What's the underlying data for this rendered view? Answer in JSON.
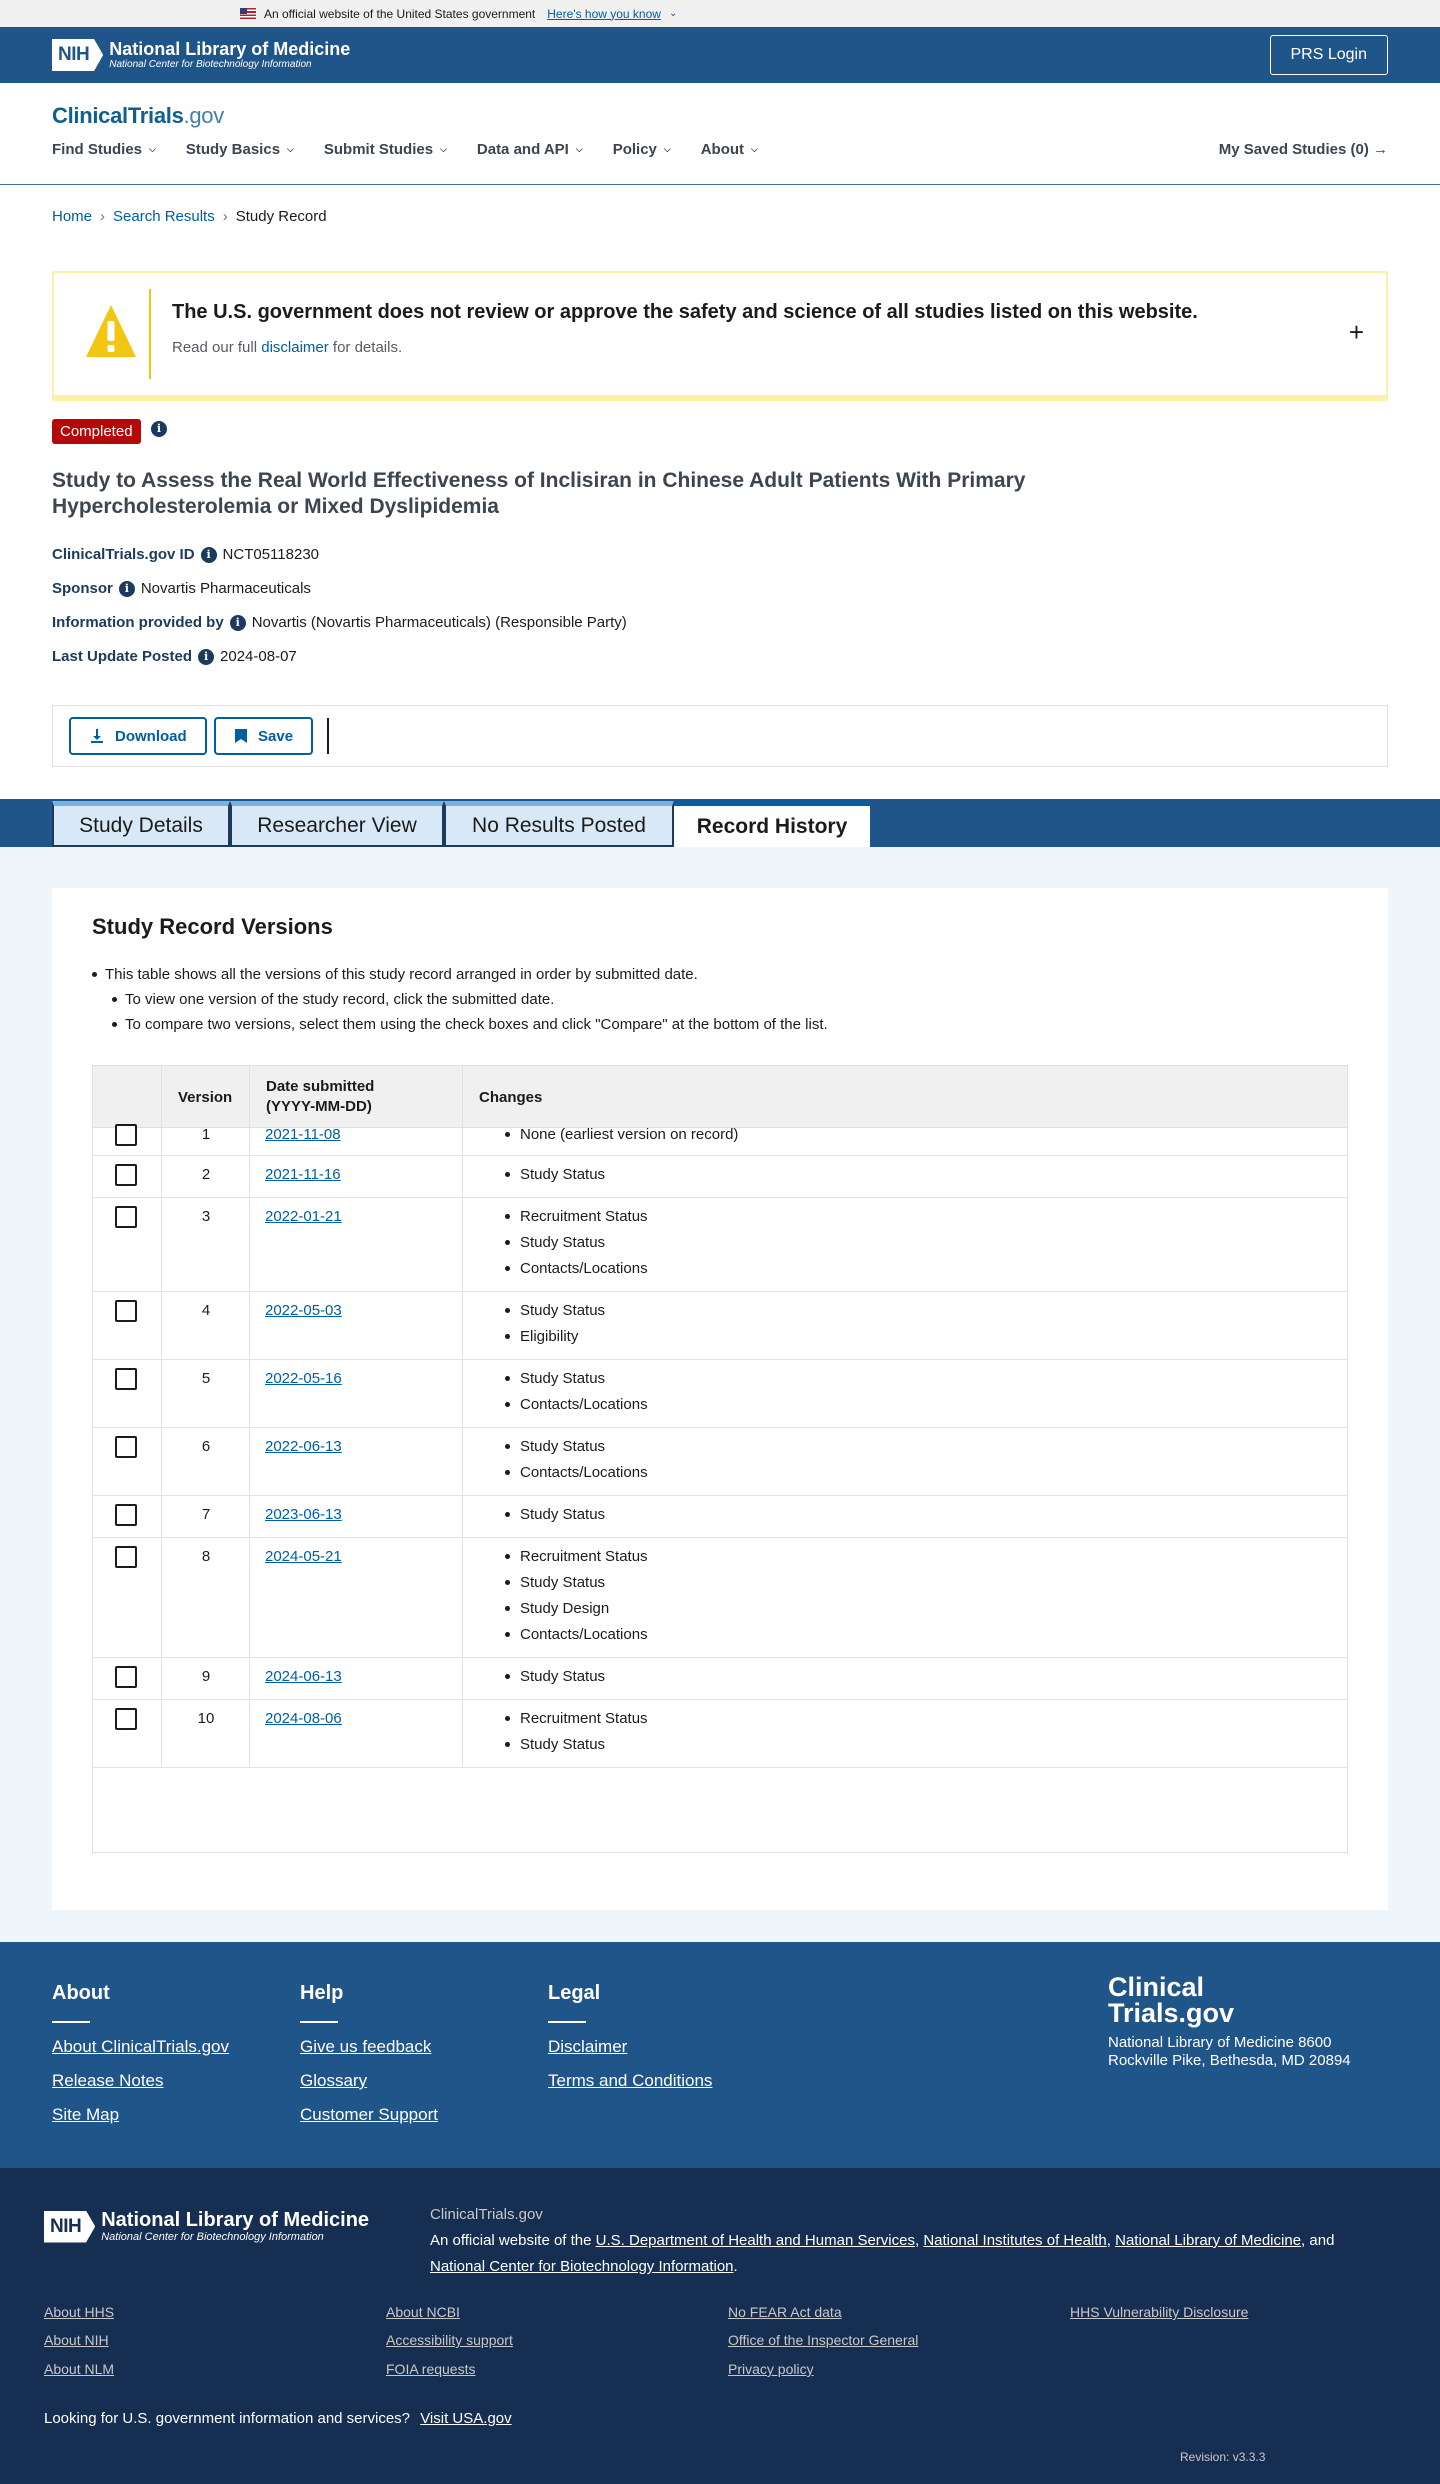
{
  "gov_banner": {
    "text": "An official website of the United States government",
    "link": "Here's how you know"
  },
  "nih": {
    "mark": "NIH",
    "title": "National Library of Medicine",
    "subtitle": "National Center for Biotechnology Information",
    "login": "PRS Login"
  },
  "site": {
    "logo_main": "ClinicalTrials",
    "logo_suffix": ".gov"
  },
  "nav": {
    "items": [
      "Find Studies",
      "Study Basics",
      "Submit Studies",
      "Data and API",
      "Policy",
      "About"
    ],
    "saved": "My Saved Studies (0)"
  },
  "breadcrumb": {
    "home": "Home",
    "search": "Search Results",
    "current": "Study Record"
  },
  "disclaimer": {
    "heading": "The U.S. government does not review or approve the safety and science of all studies listed on this website.",
    "pre": "Read our full",
    "link": "disclaimer",
    "post": "for details."
  },
  "status": {
    "badge": "Completed",
    "color": "#b50909"
  },
  "study": {
    "title": "Study to Assess the Real World Effectiveness of Inclisiran in Chinese Adult Patients With Primary Hypercholesterolemia or Mixed Dyslipidemia",
    "id_label": "ClinicalTrials.gov ID",
    "id": "NCT05118230",
    "sponsor_label": "Sponsor",
    "sponsor": "Novartis Pharmaceuticals",
    "provided_label": "Information provided by",
    "provided": "Novartis (Novartis Pharmaceuticals) (Responsible Party)",
    "update_label": "Last Update Posted",
    "update": "2024-08-07"
  },
  "actions": {
    "download": "Download",
    "save": "Save"
  },
  "tabs": [
    "Study Details",
    "Researcher View",
    "No Results Posted",
    "Record History"
  ],
  "versions": {
    "title": "Study Record Versions",
    "bullets": [
      "This table shows all the versions of this study record arranged in order by submitted date.",
      "To view one version of the study record, click the submitted date.",
      "To compare two versions, select them using the check boxes and click \"Compare\" at the bottom of the list."
    ],
    "headers": {
      "version": "Version",
      "date_line1": "Date submitted",
      "date_line2": "(YYYY-MM-DD)",
      "changes": "Changes"
    },
    "rows": [
      {
        "version": "1",
        "date": "2021-11-08",
        "changes": [
          "None (earliest version on record)"
        ]
      },
      {
        "version": "2",
        "date": "2021-11-16",
        "changes": [
          "Study Status"
        ]
      },
      {
        "version": "3",
        "date": "2022-01-21",
        "changes": [
          "Recruitment Status",
          "Study Status",
          "Contacts/Locations"
        ]
      },
      {
        "version": "4",
        "date": "2022-05-03",
        "changes": [
          "Study Status",
          "Eligibility"
        ]
      },
      {
        "version": "5",
        "date": "2022-05-16",
        "changes": [
          "Study Status",
          "Contacts/Locations"
        ]
      },
      {
        "version": "6",
        "date": "2022-06-13",
        "changes": [
          "Study Status",
          "Contacts/Locations"
        ]
      },
      {
        "version": "7",
        "date": "2023-06-13",
        "changes": [
          "Study Status"
        ]
      },
      {
        "version": "8",
        "date": "2024-05-21",
        "changes": [
          "Recruitment Status",
          "Study Status",
          "Study Design",
          "Contacts/Locations"
        ]
      },
      {
        "version": "9",
        "date": "2024-06-13",
        "changes": [
          "Study Status"
        ]
      },
      {
        "version": "10",
        "date": "2024-08-06",
        "changes": [
          "Recruitment Status",
          "Study Status"
        ]
      }
    ]
  },
  "footer": {
    "about": {
      "heading": "About",
      "links": [
        "About ClinicalTrials.gov",
        "Release Notes",
        "Site Map"
      ]
    },
    "help": {
      "heading": "Help",
      "links": [
        "Give us feedback",
        "Glossary",
        "Customer Support"
      ]
    },
    "legal": {
      "heading": "Legal",
      "links": [
        "Disclaimer",
        "Terms and Conditions"
      ]
    },
    "brand_line1": "Clinical",
    "brand_line2": "Trials.gov",
    "address": "National Library of Medicine 8600 Rockville Pike, Bethesda, MD 20894"
  },
  "footer2": {
    "site": "ClinicalTrials.gov",
    "official_pre": "An official website of the",
    "hhs": "U.S. Department of Health and Human Services",
    "nih": "National Institutes of Health",
    "nlm": "National Library of Medicine",
    "and": "and",
    "ncbi": "National Center for Biotechnology Information",
    "links": [
      "About HHS",
      "About NIH",
      "About NLM",
      "About NCBI",
      "Accessibility support",
      "FOIA requests",
      "No FEAR Act data",
      "Office of the Inspector General",
      "Privacy policy",
      "HHS Vulnerability Disclosure"
    ],
    "usa_q": "Looking for U.S. government information and services?",
    "usa_link": "Visit USA.gov",
    "revision": "Revision: v3.3.3"
  }
}
